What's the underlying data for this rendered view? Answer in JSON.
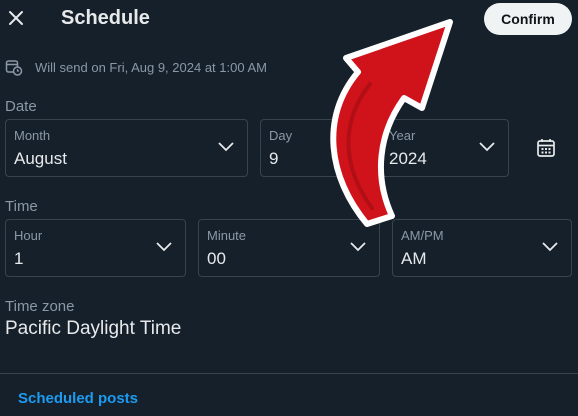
{
  "header": {
    "title": "Schedule",
    "confirm_label": "Confirm",
    "close_icon": "close-icon"
  },
  "send_info": {
    "icon": "calendar-clock-icon",
    "text": "Will send on Fri, Aug 9, 2024 at 1:00 AM"
  },
  "date": {
    "section_label": "Date",
    "month": {
      "label": "Month",
      "value": "August"
    },
    "day": {
      "label": "Day",
      "value": "9"
    },
    "year": {
      "label": "Year",
      "value": "2024"
    },
    "calendar_icon": "calendar-icon"
  },
  "time": {
    "section_label": "Time",
    "hour": {
      "label": "Hour",
      "value": "1"
    },
    "minute": {
      "label": "Minute",
      "value": "00"
    },
    "ampm": {
      "label": "AM/PM",
      "value": "AM"
    }
  },
  "timezone": {
    "label": "Time zone",
    "value": "Pacific Daylight Time"
  },
  "footer": {
    "scheduled_posts_link": "Scheduled posts"
  },
  "colors": {
    "background": "#15202b",
    "accent": "#1d9bf0",
    "annotation_arrow": "#d0121b"
  }
}
